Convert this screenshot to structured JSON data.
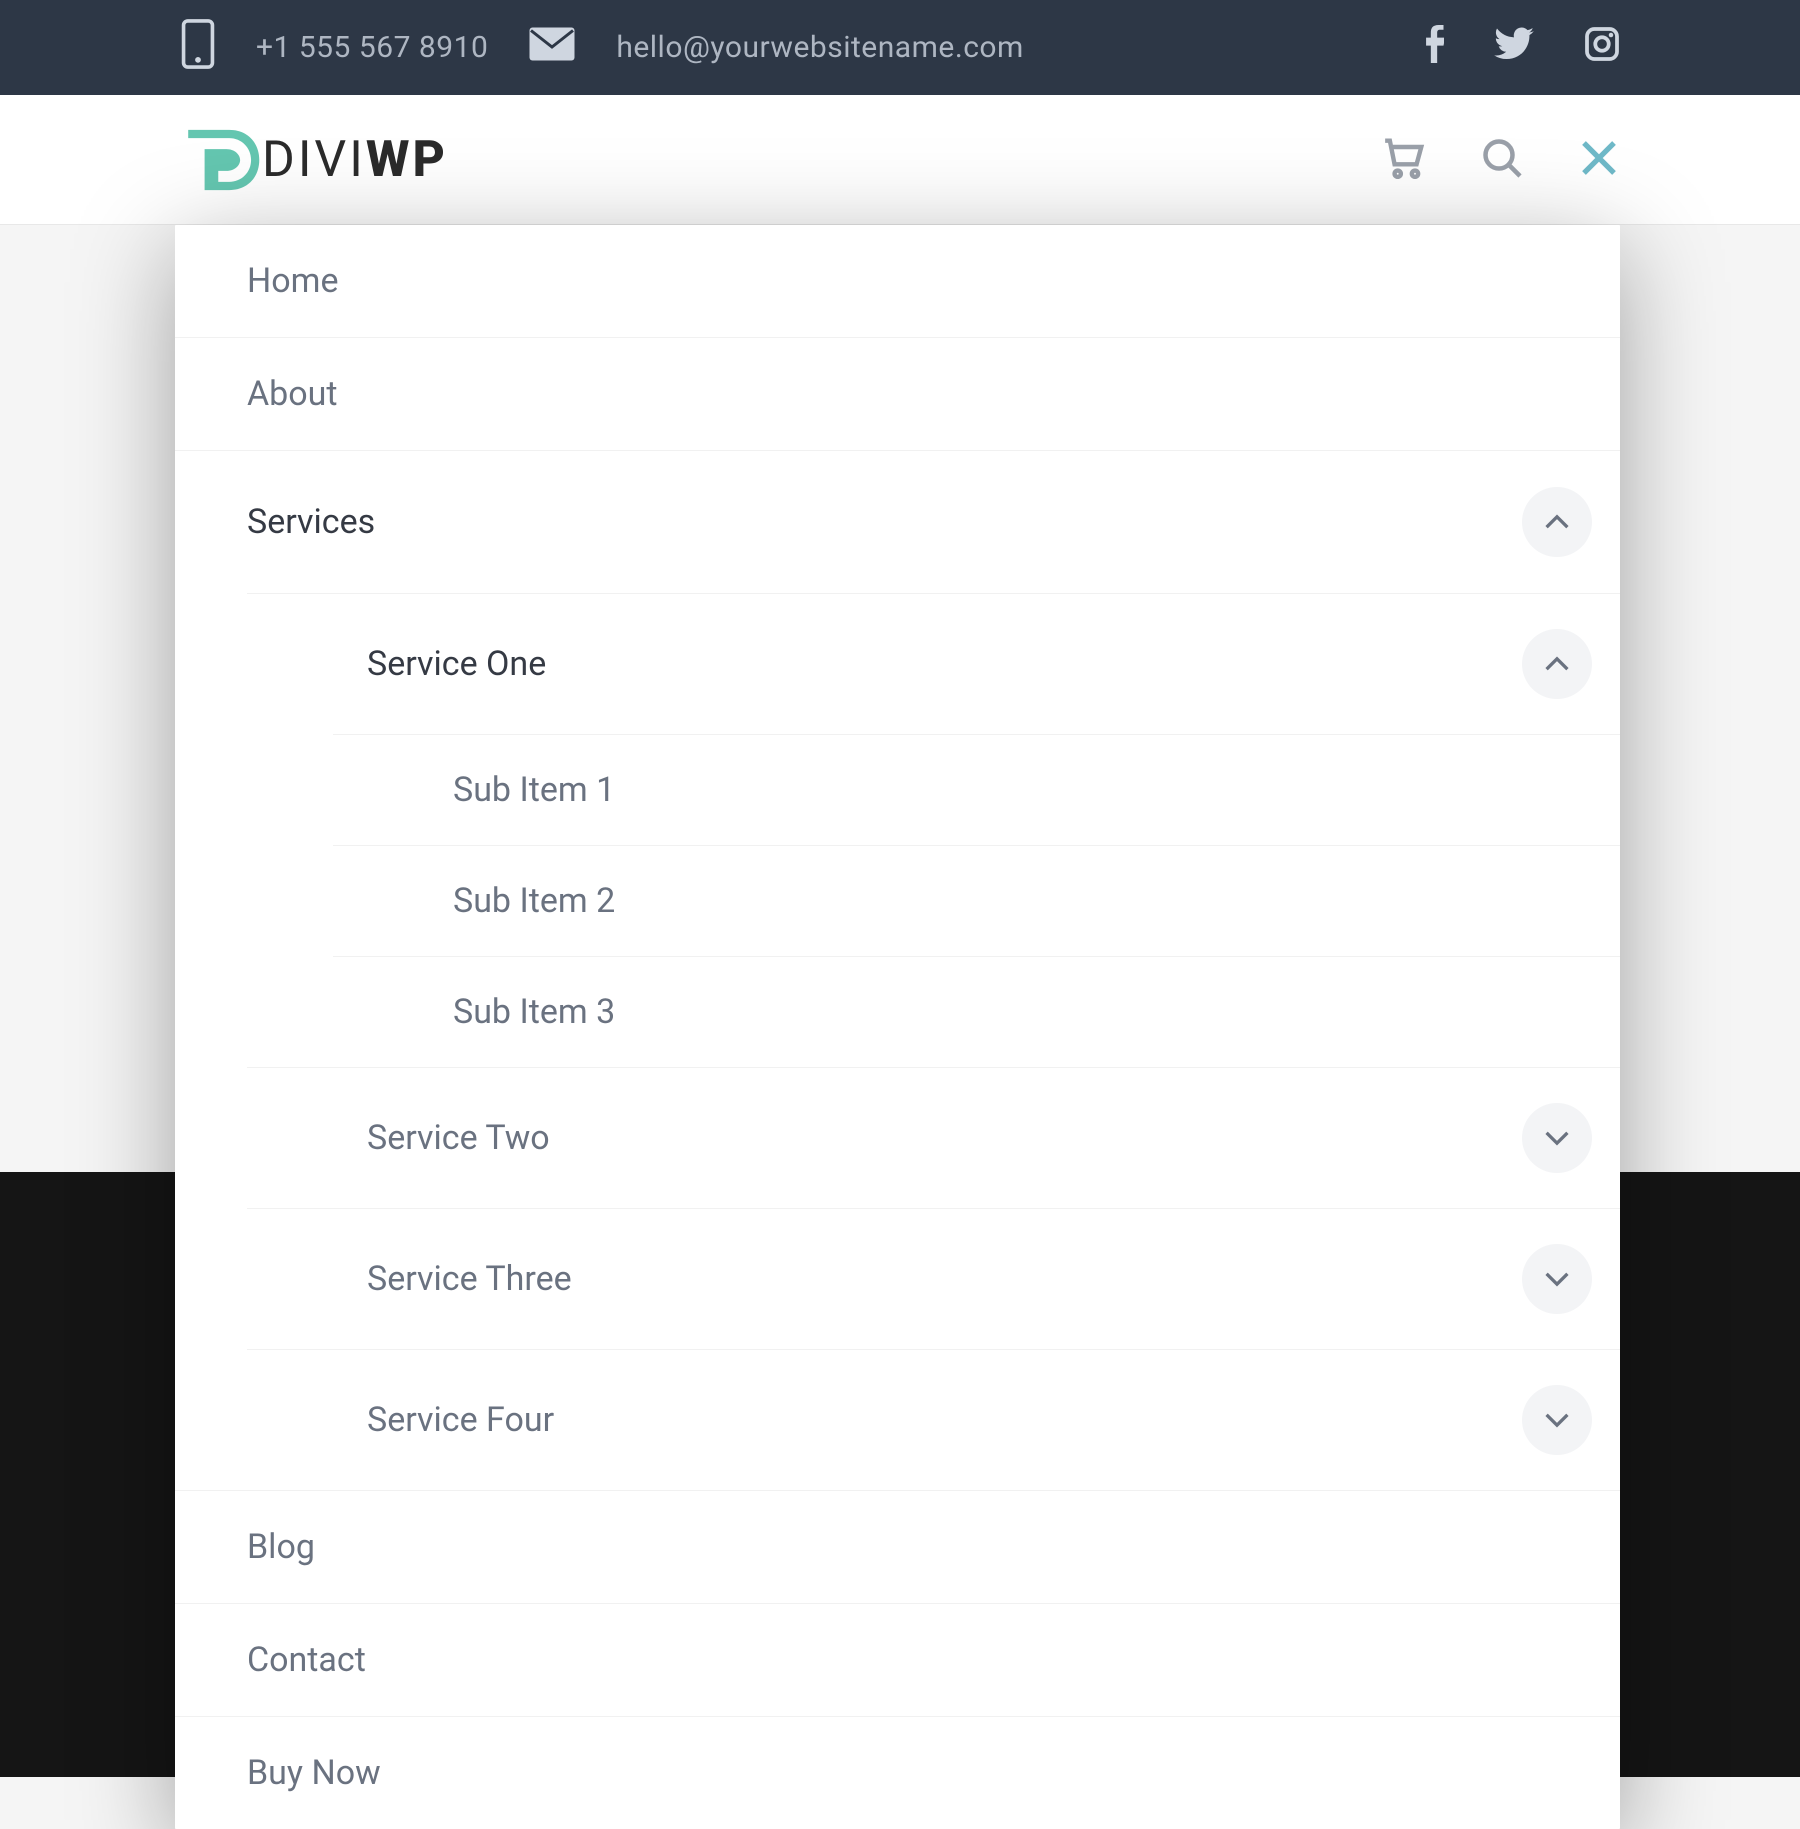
{
  "topbar": {
    "phone": "+1 555 567 8910",
    "email": "hello@yourwebsitename.com"
  },
  "logo": {
    "mark": "D",
    "text_light": "DIVI",
    "text_bold": "WP"
  },
  "menu": {
    "items": [
      {
        "label": "Home"
      },
      {
        "label": "About"
      },
      {
        "label": "Services",
        "expanded": true,
        "children": [
          {
            "label": "Service One",
            "expanded": true,
            "children": [
              {
                "label": "Sub Item 1"
              },
              {
                "label": "Sub Item 2"
              },
              {
                "label": "Sub Item 3"
              }
            ]
          },
          {
            "label": "Service Two",
            "expanded": false
          },
          {
            "label": "Service Three",
            "expanded": false
          },
          {
            "label": "Service Four",
            "expanded": false
          }
        ]
      },
      {
        "label": "Blog"
      },
      {
        "label": "Contact"
      },
      {
        "label": "Buy Now"
      }
    ]
  }
}
